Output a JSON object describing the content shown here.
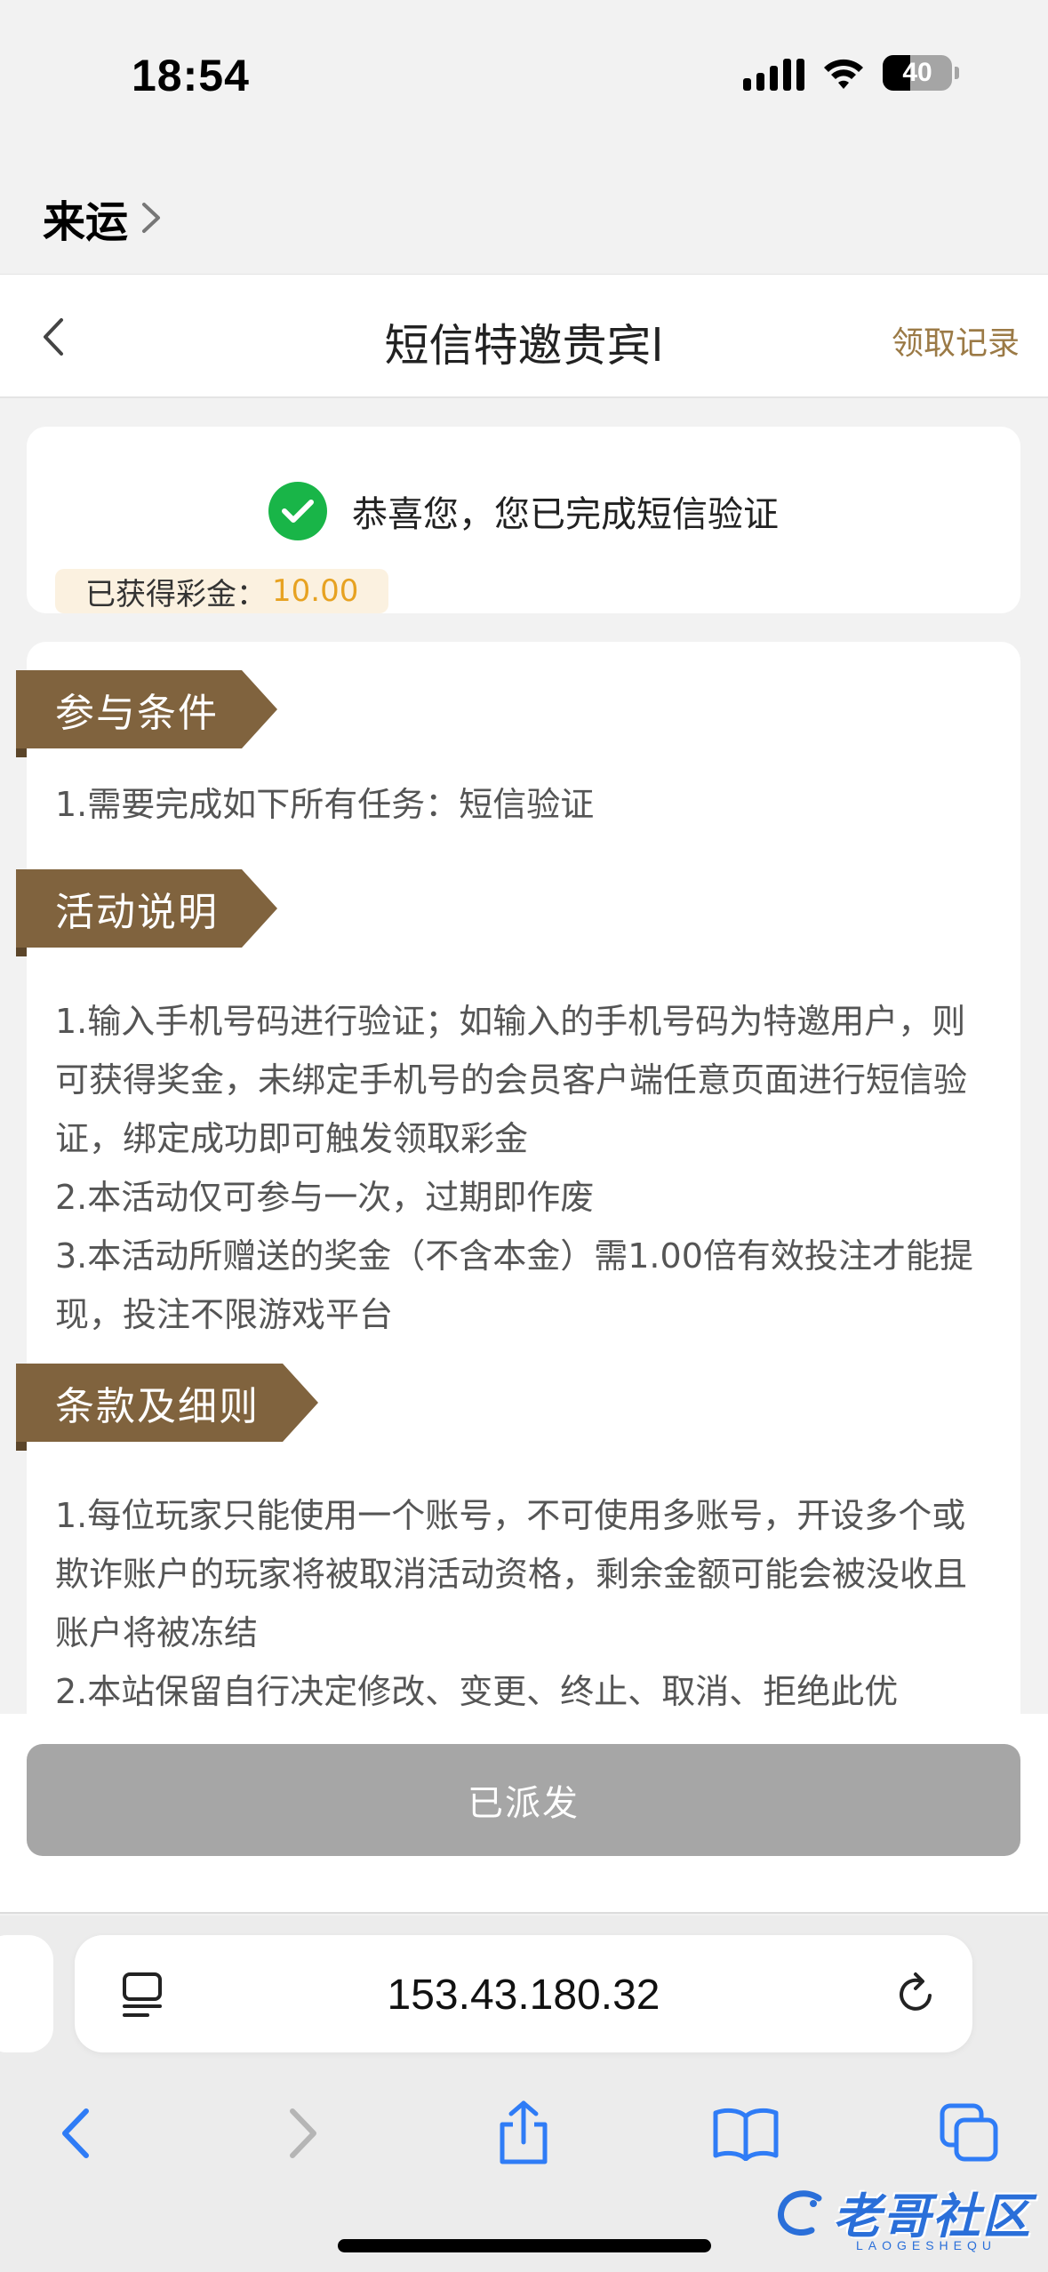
{
  "status_bar": {
    "time": "18:54",
    "battery": "40",
    "icons": [
      "signal-icon",
      "wifi-icon",
      "battery-icon"
    ]
  },
  "app_back": {
    "label": "来运"
  },
  "navbar": {
    "title": "短信特邀贵宾l",
    "right_link": "领取记录"
  },
  "success": {
    "message": "恭喜您，您已完成短信验证",
    "bonus_label": "已获得彩金：",
    "bonus_value": "10.00"
  },
  "sections": [
    {
      "label": "参与条件",
      "lines": [
        "1.需要完成如下所有任务：短信验证"
      ]
    },
    {
      "label": "活动说明",
      "lines": [
        "1.输入手机号码进行验证；如输入的手机号码为特邀用户，则可获得奖金，未绑定手机号的会员客户端任意页面进行短信验证，绑定成功即可触发领取彩金",
        "2.本活动仅可参与一次，过期即作废",
        "3.本活动所赠送的奖金（不含本金）需1.00倍有效投注才能提现，投注不限游戏平台"
      ]
    },
    {
      "label": "条款及细则",
      "lines": [
        "1.每位玩家只能使用一个账号，不可使用多账号，开设多个或欺诈账户的玩家将被取消活动资格，剩余金额可能会被没收且账户将被冻结",
        "2.本站保留自行决定修改、变更、终止、取消、拒绝此优"
      ]
    }
  ],
  "action": {
    "button_label": "已派发"
  },
  "safari": {
    "url": "153.43.180.32"
  },
  "watermark": {
    "text": "老哥社区",
    "sub": "LAOGESHEQU"
  },
  "colors": {
    "accent_brown": "#80633e",
    "link_gold": "#9b7a46",
    "bonus_orange": "#e7a221",
    "success_green": "#19b548",
    "disabled_gray": "#a6a6a6",
    "ios_blue": "#2f7cf6"
  }
}
